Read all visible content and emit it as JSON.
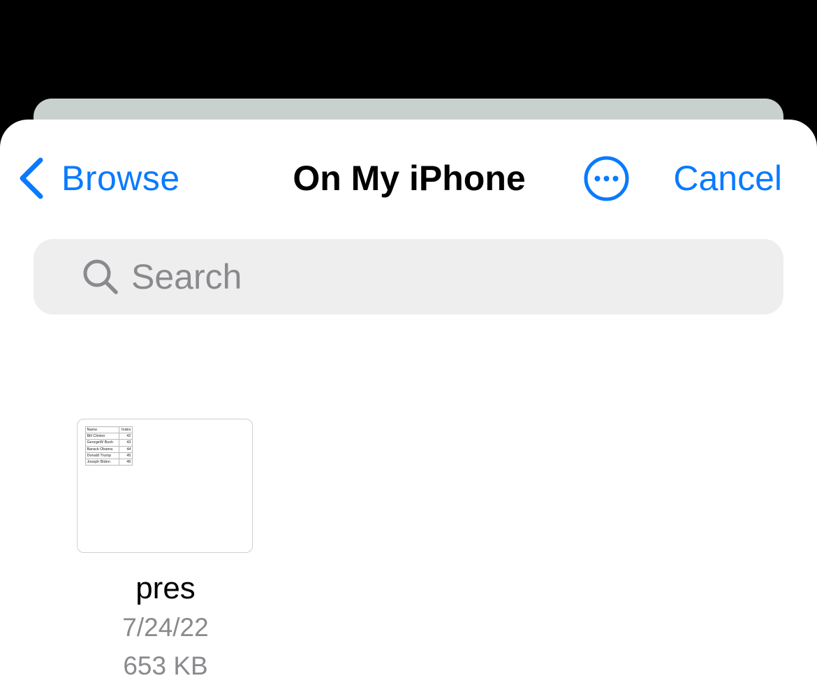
{
  "nav": {
    "back_label": "Browse",
    "title": "On My iPhone",
    "cancel_label": "Cancel",
    "more_icon": "ellipsis-circle-icon",
    "back_icon": "chevron-left-icon"
  },
  "search": {
    "placeholder": "Search",
    "value": "",
    "icon": "magnifying-glass-icon"
  },
  "files": [
    {
      "name": "pres",
      "date": "7/24/22",
      "size": "653 KB",
      "thumbnail": {
        "headers": [
          "Name",
          "Index"
        ],
        "rows": [
          [
            "Bill Clinton",
            "42"
          ],
          [
            "GeorgeW Bush",
            "43"
          ],
          [
            "Barack Obama",
            "44"
          ],
          [
            "Donald Trump",
            "45"
          ],
          [
            "Joseph Biden",
            "46"
          ]
        ]
      }
    }
  ],
  "colors": {
    "accent": "#0a7aff",
    "backdrop": "#000000",
    "sheet": "#ffffff",
    "search_bg": "#eeeeef",
    "secondary_text": "#8a8a8e"
  }
}
